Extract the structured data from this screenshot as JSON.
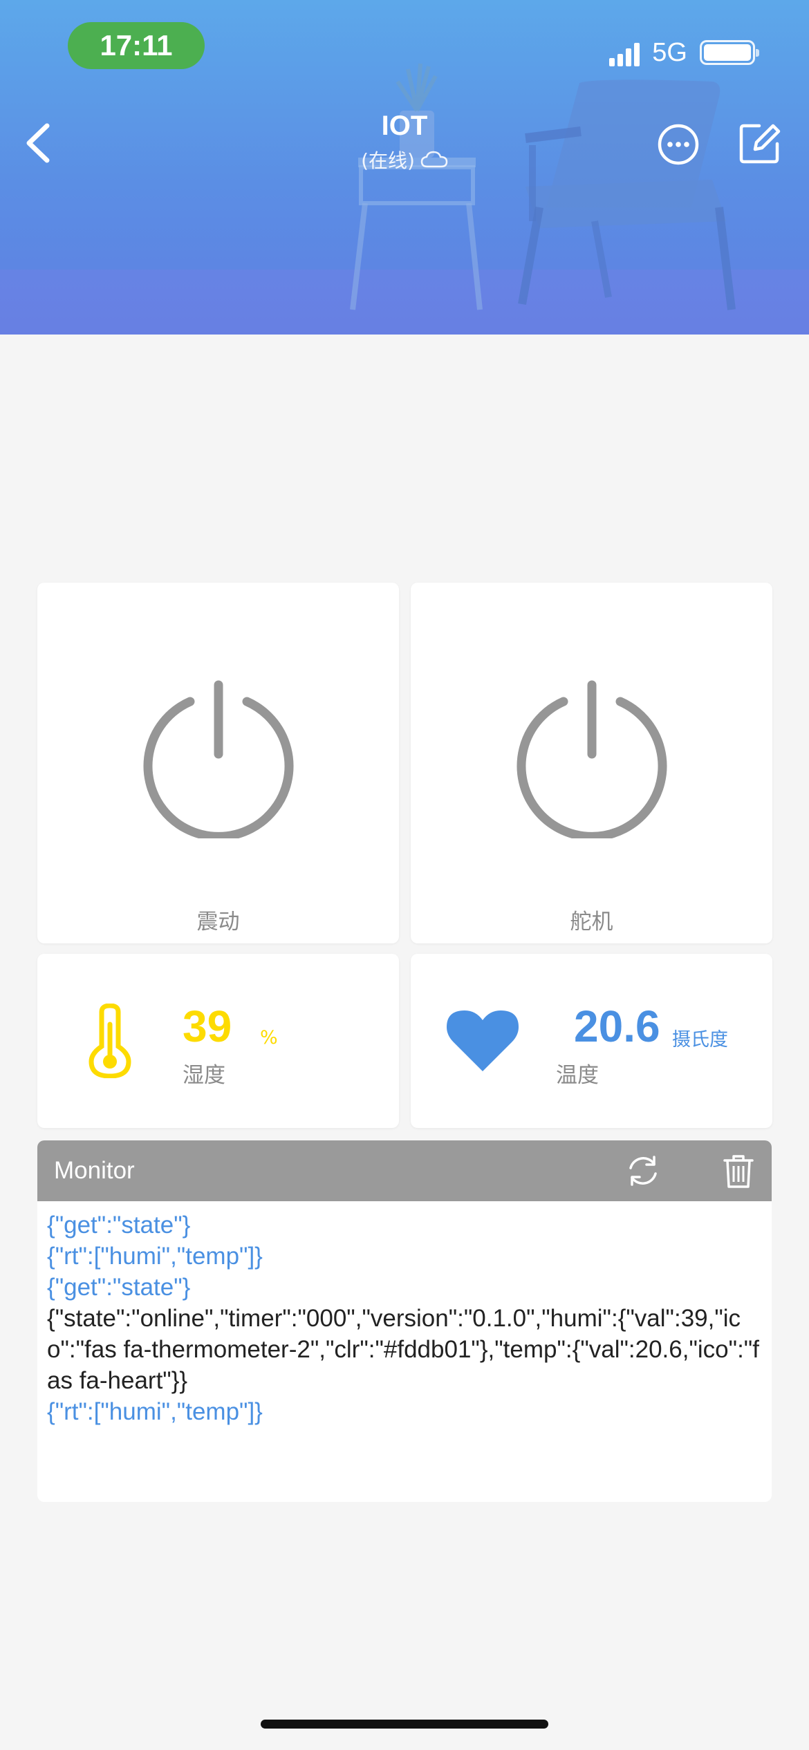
{
  "status_bar": {
    "time": "17:11",
    "network": "5G"
  },
  "header": {
    "title": "IOT",
    "subtitle": "(在线)"
  },
  "switches": [
    {
      "label": "震动"
    },
    {
      "label": "舵机"
    }
  ],
  "sensors": {
    "humidity": {
      "value": "39",
      "unit": "%",
      "name": "湿度",
      "icon": "thermometer-icon",
      "color": "#fddb01"
    },
    "temperature": {
      "value": "20.6",
      "unit": "摄氏度",
      "name": "温度",
      "icon": "heart-icon",
      "color": "#4a90e2"
    }
  },
  "monitor": {
    "title": "Monitor",
    "log": [
      {
        "type": "sent",
        "text": "{\"get\":\"state\"}"
      },
      {
        "type": "sent",
        "text": "{\"rt\":[\"humi\",\"temp\"]}"
      },
      {
        "type": "sent",
        "text": "{\"get\":\"state\"}"
      },
      {
        "type": "recv",
        "text": "{\"state\":\"online\",\"timer\":\"000\",\"version\":\"0.1.0\",\"humi\":{\"val\":39,\"ico\":\"fas fa-thermometer-2\",\"clr\":\"#fddb01\"},\"temp\":{\"val\":20.6,\"ico\":\"fas fa-heart\"}}"
      },
      {
        "type": "sent",
        "text": "{\"rt\":[\"humi\",\"temp\"]}"
      }
    ]
  },
  "colors": {
    "accent_blue": "#4a90e2",
    "humidity_yellow": "#fddb01",
    "power_grey": "#969696",
    "monitor_header": "#9a9a9a"
  }
}
